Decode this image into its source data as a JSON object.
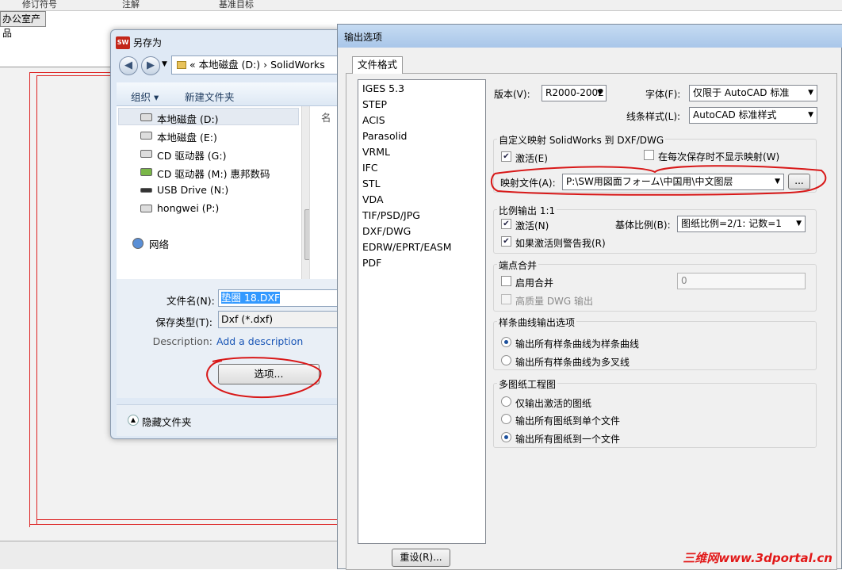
{
  "background": {
    "toolbar_items": [
      "修订符号",
      "注解",
      "基准目标"
    ],
    "tag": "办公室产品"
  },
  "save_dialog": {
    "title": "另存为",
    "address": "« 本地磁盘 (D:) › SolidWorks",
    "organize": "组织 ▾",
    "new_folder": "新建文件夹",
    "col_name": "名",
    "tree": [
      "本地磁盘 (D:)",
      "本地磁盘 (E:)",
      "CD 驱动器 (G:)",
      "CD 驱动器 (M:) 惠邦数码",
      "USB Drive (N:)",
      "hongwei (P:)",
      "网络"
    ],
    "filename_label": "文件名(N):",
    "filename_value": "垫圈 18.DXF",
    "filetype_label": "保存类型(T):",
    "filetype_value": "Dxf (*.dxf)",
    "description_label": "Description:",
    "description_link": "Add a description",
    "options_button": "选项...",
    "hide_folders": "隐藏文件夹"
  },
  "output_dialog": {
    "title": "输出选项",
    "tab": "文件格式",
    "formats": [
      "IGES 5.3",
      "STEP",
      "ACIS",
      "Parasolid",
      "VRML",
      "IFC",
      "STL",
      "VDA",
      "TIF/PSD/JPG",
      "DXF/DWG",
      "EDRW/EPRT/EASM",
      "PDF"
    ],
    "reset": "重设(R)...",
    "version_label": "版本(V):",
    "version_value": "R2000-2002",
    "font_label": "字体(F):",
    "font_value": "仅限于 AutoCAD 标准",
    "linestyle_label": "线条样式(L):",
    "linestyle_value": "AutoCAD 标准样式",
    "mapping_group": "自定义映射 SolidWorks 到 DXF/DWG",
    "activate_e": "激活(E)",
    "no_show_mapping": "在每次保存时不显示映射(W)",
    "mapfile_label": "映射文件(A):",
    "mapfile_value": "P:\\SW用図面フォーム\\中国用\\中文图层",
    "browse": "...",
    "scale_group": "比例输出 1:1",
    "activate_n": "激活(N)",
    "base_scale_label": "基体比例(B):",
    "base_scale_value": "图纸比例=2/1: 记数=1",
    "warn_if_active": "如果激活则警告我(R)",
    "endpoint_group": "端点合并",
    "enable_merge": "启用合并",
    "merge_value": "0",
    "hq_dwg": "高质量 DWG 输出",
    "spline_group": "样条曲线输出选项",
    "spline_opt1": "输出所有样条曲线为样条曲线",
    "spline_opt2": "输出所有样条曲线为多叉线",
    "multisheet_group": "多图纸工程图",
    "sheet_opt1": "仅输出激活的图纸",
    "sheet_opt2": "输出所有图纸到单个文件",
    "sheet_opt3": "输出所有图纸到一个文件"
  },
  "watermark": "三维网www.3dportal.cn",
  "annotation_color": "#d81818"
}
